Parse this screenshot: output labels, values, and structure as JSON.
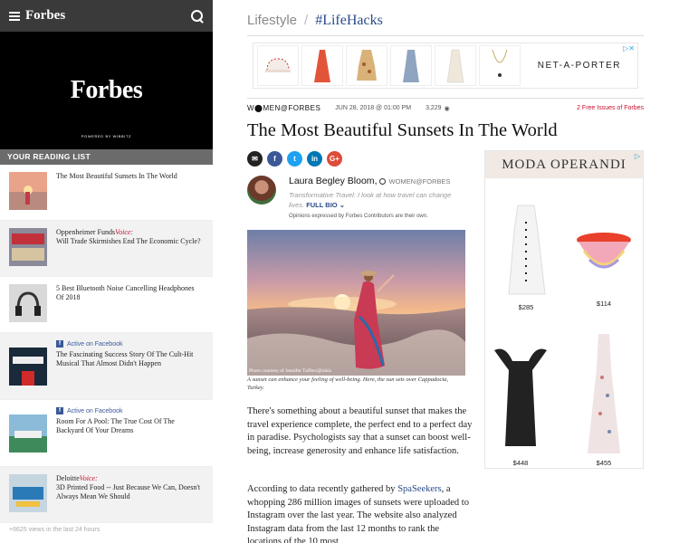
{
  "topbar": {
    "logo": "Forbes"
  },
  "video": {
    "logo": "Forbes",
    "powered": "POWERED BY WIBBITZ"
  },
  "reading_list": {
    "header": "YOUR READING LIST",
    "items": [
      {
        "title": "The Most Beautiful Sunsets In The World"
      },
      {
        "sponsor": "Oppenheimer Funds",
        "voice": "Voice:",
        "title": "Will Trade Skirmishes End The Economic Cycle?"
      },
      {
        "title": "5 Best Bluetooth Noise Cancelling Headphones Of 2018"
      },
      {
        "fb": "Active on Facebook",
        "title": "The Fascinating Success Story Of The Cult-Hit Musical That Almost Didn't Happen"
      },
      {
        "fb": "Active on Facebook",
        "title": "Room For A Pool: The True Cost Of The Backyard Of Your Dreams"
      },
      {
        "sponsor": "Deloitte",
        "voice": "Voice:",
        "title": "3D Printed Food -- Just Because We Can, Doesn't Always Mean We Should"
      }
    ],
    "footer": "+6625 views in the last 24 hours"
  },
  "breadcrumb": {
    "section": "Lifestyle",
    "separator": "/",
    "tag": "#LifeHacks"
  },
  "ad_top": {
    "logo": "NET-A-PORTER"
  },
  "byline_bar": {
    "brand": "W⬤MEN@FORBES",
    "date": "JUN 28, 2018 @ 01:00 PM",
    "views": "3,229",
    "free": "2 Free Issues of Forbes"
  },
  "article": {
    "headline": "The Most Beautiful Sunsets In The World",
    "author": "Laura Begley Bloom",
    "author_affil": "WOMEN@FORBES",
    "author_desc": "Transformative Travel: I look at how travel can change lives.",
    "full_bio": "FULL BIO",
    "disclaimer": "Opinions expressed by Forbes Contributors are their own.",
    "photo_credit": "Photo courtesy of Jennifer Tuffen/@izkiz",
    "caption": "A sunset can enhance your feeling of well-being. Here, the sun sets over Cappadocia, Turkey.",
    "para1": "There's something about a beautiful sunset that makes the travel experience complete, the perfect end to a perfect day in paradise. Psychologists say that a sunset can boost well-being, increase generosity and enhance life satisfaction.",
    "para2_pre": "According to data recently gathered by ",
    "para2_link": "SpaSeekers",
    "para2_post": ", a whopping 286 million images of sunsets were uploaded to Instagram over the last year. The website also analyzed Instagram data from the last 12 months to rank the locations of the 10 most"
  },
  "share": [
    "✉",
    "f",
    "t",
    "in",
    "G+"
  ],
  "ad_side": {
    "brand": "MODA OPERANDI",
    "prices": [
      "$285",
      "$114",
      "$448",
      "$455"
    ]
  }
}
